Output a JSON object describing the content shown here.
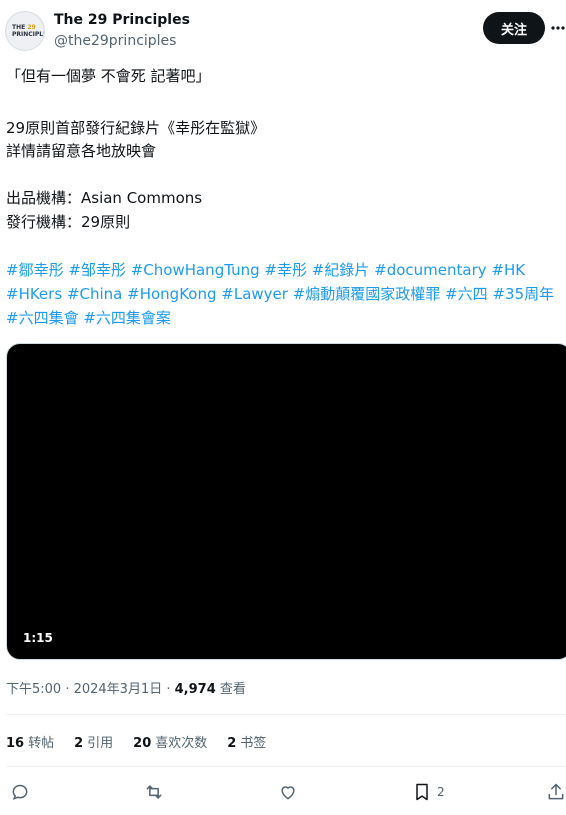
{
  "user": {
    "display_name": "The 29 Principles",
    "handle": "@the29principles",
    "follow_label": "关注",
    "avatar_text": "THE 29 PRINCIPLES"
  },
  "tweet": {
    "line1": "「但有一個夢 不會死 記著吧」",
    "line2": "29原則首部發行紀錄片《幸彤在監獄》",
    "line3": "詳情請留意各地放映會",
    "line4": "出品機構：Asian Commons",
    "line5": "發行機構：29原則",
    "hashtags": [
      "#鄒幸彤",
      "#邹幸彤",
      "#ChowHangTung",
      "#幸彤",
      "#紀錄片",
      "#documentary",
      "#HK",
      "#HKers",
      "#China",
      "#HongKong",
      "#Lawyer",
      "#煽動顛覆國家政權罪",
      "#六四",
      "#35周年",
      "#六四集會",
      "#六四集會案"
    ]
  },
  "video": {
    "duration": "1:15"
  },
  "meta": {
    "time_date": "下午5:00 · 2024年3月1日 · ",
    "views": "4,974",
    "views_label": " 查看"
  },
  "stats": {
    "reposts": "16",
    "reposts_label": "转帖",
    "quotes": "2",
    "quotes_label": "引用",
    "likes": "20",
    "likes_label": "喜欢次数",
    "bookmarks": "2",
    "bookmarks_label": "书签"
  },
  "actions": {
    "bookmark_count": "2"
  },
  "colors": {
    "link": "#1d9bf0",
    "text": "#0f1419",
    "muted": "#536471"
  },
  "icons": [
    "more-icon",
    "reply-icon",
    "repost-icon",
    "like-icon",
    "bookmark-icon",
    "share-icon"
  ]
}
